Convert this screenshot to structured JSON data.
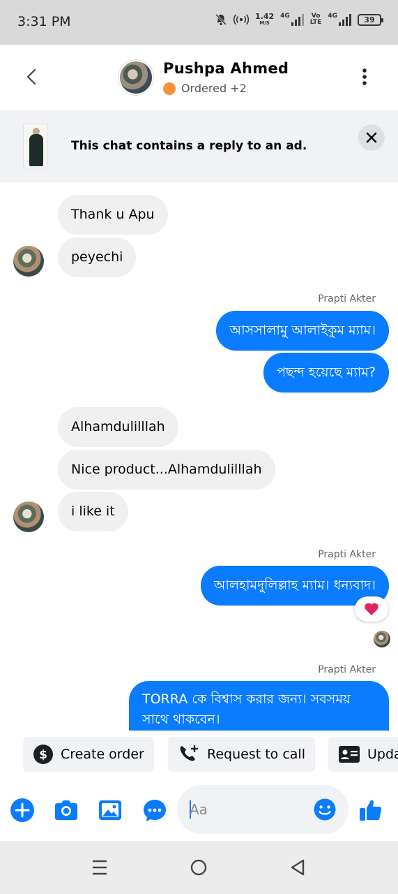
{
  "status_bar": {
    "time": "3:31 PM",
    "speed_value": "1.42",
    "speed_unit": "M/S",
    "net1": "4G",
    "net2_top": "Vo",
    "net2_bottom": "LTE",
    "net3": "4G",
    "battery": "39"
  },
  "header": {
    "name": "Pushpa Ahmed",
    "status": "Ordered +2",
    "status_color": "#f7923a"
  },
  "ad_banner": {
    "text": "This chat contains a reply to an ad."
  },
  "messages": {
    "m1": "Thank u Apu",
    "m2": "peyechi",
    "sender1": "Prapti Akter",
    "m3": "আসসালামু আলাইকুম ম্যাম।",
    "m4": "পছন্দ হয়েছে ম্যাম?",
    "m5": "Alhamdulilllah",
    "m6": "Nice product...Alhamdulilllah",
    "m7": "i like it",
    "sender2": "Prapti Akter",
    "m8": "আলহামদুলিল্লাহ ম্যাম। ধন্যবাদ।",
    "reaction": "❤️",
    "sender3": "Prapti Akter",
    "m9": "TORRA কে বিশ্বাস করার জন্য। সবসময় সাথে থাকবেন।"
  },
  "quick_actions": {
    "create_order": "Create order",
    "request_call": "Request to call",
    "update": "Upda"
  },
  "composer": {
    "placeholder": "Aa"
  },
  "colors": {
    "accent": "#0a7cff",
    "incoming_bubble": "#f0f0f0"
  }
}
